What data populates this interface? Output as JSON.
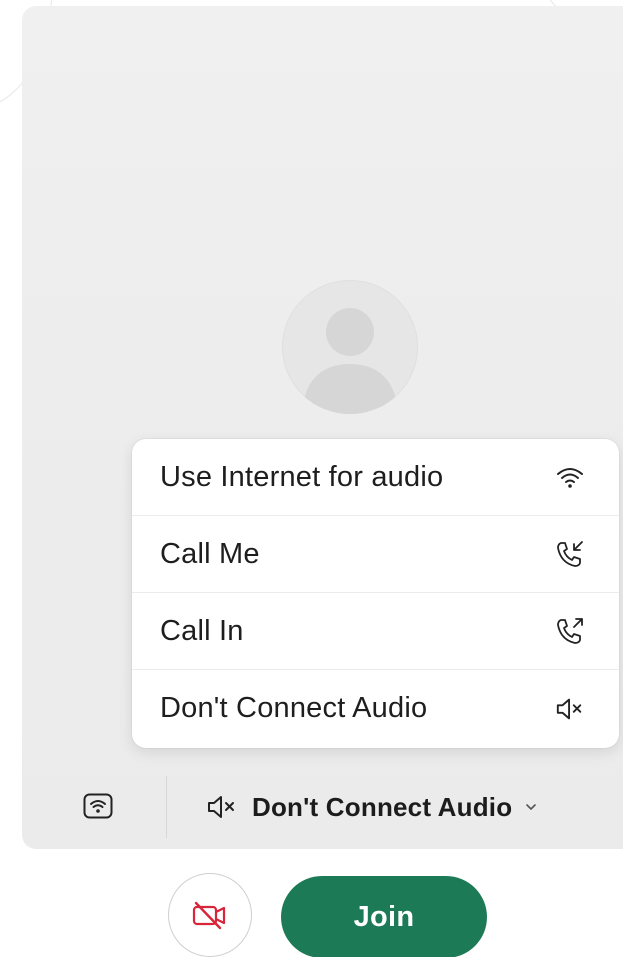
{
  "audio_menu": {
    "items": [
      {
        "label": "Use Internet for audio",
        "icon": "wifi-icon"
      },
      {
        "label": "Call Me",
        "icon": "call-me-icon"
      },
      {
        "label": "Call In",
        "icon": "call-in-icon"
      },
      {
        "label": "Don't Connect Audio",
        "icon": "speaker-muted-icon"
      }
    ]
  },
  "bottom_bar": {
    "connect_icon": "wifi-box-icon",
    "audio_selection_label": "Don't Connect Audio",
    "audio_selection_icon": "speaker-muted-icon",
    "dropdown_icon": "chevron-down-icon"
  },
  "actions": {
    "video_icon": "video-off-icon",
    "join_label": "Join"
  },
  "colors": {
    "join_green": "#1c7a56",
    "video_off_red": "#d9253b",
    "card_bg": "#eeeeee"
  }
}
